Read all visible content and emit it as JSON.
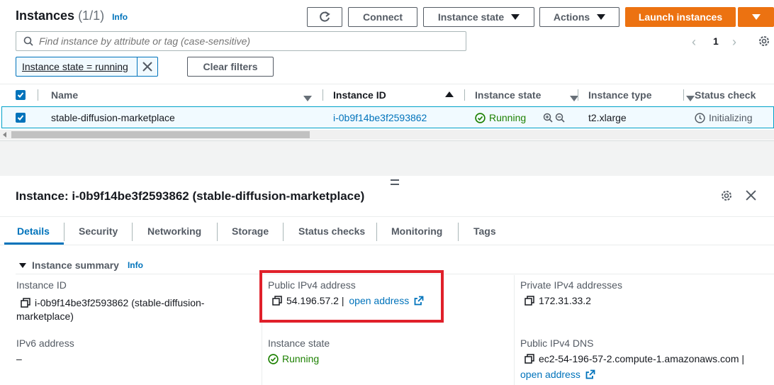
{
  "header": {
    "title": "Instances",
    "count": "(1/1)",
    "info": "Info",
    "connect_label": "Connect",
    "instance_state_label": "Instance state",
    "actions_label": "Actions",
    "launch_label": "Launch instances"
  },
  "search": {
    "placeholder": "Find instance by attribute or tag (case-sensitive)"
  },
  "pagination": {
    "page": "1"
  },
  "filters": {
    "chip": "Instance state = running",
    "clear_label": "Clear filters"
  },
  "table": {
    "columns": [
      "Name",
      "Instance ID",
      "Instance state",
      "Instance type",
      "Status check"
    ],
    "rows": [
      {
        "name": "stable-diffusion-marketplace",
        "instance_id": "i-0b9f14be3f2593862",
        "state": "Running",
        "type": "t2.xlarge",
        "status": "Initializing"
      }
    ]
  },
  "details": {
    "title": "Instance: i-0b9f14be3f2593862 (stable-diffusion-marketplace)",
    "tabs": [
      "Details",
      "Security",
      "Networking",
      "Storage",
      "Status checks",
      "Monitoring",
      "Tags"
    ],
    "summary_title": "Instance summary",
    "summary_info": "Info",
    "instance_id_label": "Instance ID",
    "instance_id_value_1": "i-0b9f14be3f2593862 (stable-diffusion-",
    "instance_id_value_2": "marketplace)",
    "public_ipv4_label": "Public IPv4 address",
    "public_ipv4_value": "54.196.57.2 |",
    "open_address": "open address",
    "private_ipv4_label": "Private IPv4 addresses",
    "private_ipv4_value": "172.31.33.2",
    "ipv6_label": "IPv6 address",
    "ipv6_value": "–",
    "state_label": "Instance state",
    "state_value": "Running",
    "dns_label": "Public IPv4 DNS",
    "dns_value": "ec2-54-196-57-2.compute-1.amazonaws.com |",
    "dns_open_address": "open address"
  },
  "colors": {
    "accent": "#0073bb",
    "launch": "#ec7211",
    "running": "#1d8102",
    "highlight": "#e0202a"
  }
}
